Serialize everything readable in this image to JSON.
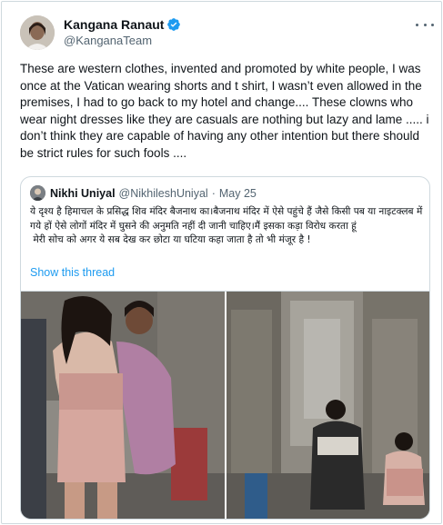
{
  "tweet": {
    "author": {
      "name": "Kangana Ranaut",
      "handle": "@KanganaTeam",
      "verified_color": "#1d9bf0"
    },
    "text": "These are western clothes, invented and promoted by white people, I was once at the Vatican wearing shorts and t shirt, I wasn’t even allowed in the premises, I had to go back to my hotel and change.... These clowns who wear night dresses like they are casuals are nothing but lazy and lame ..... i don’t think they are capable of having any other intention but there should be strict rules for such fools ...."
  },
  "quoted": {
    "author_name": "Nikhi Uniyal",
    "handle": "@NikhileshUniyal",
    "separator": "·",
    "date": "May 25",
    "text": "ये दृश्य है हिमाचल के प्रसिद्ध शिव मंदिर बैजनाथ का।बैजनाथ मंदिर में ऐसे पहुंचे हैं जैसे किसी पब या नाइटक्लब में गये हों ऐसे लोगों मंदिर में घुसने की अनुमति नहीं दी जानी चाहिए।मैं इसका कड़ा विरोध करता हूं\n मेरी सोच को अगर ये सब देख कर छोटा या घटिया कहा जाता है तो भी मंजूर है !",
    "show_thread": "Show this thread"
  },
  "icons": {
    "verified": "verified-badge-icon",
    "more": "more-options-icon"
  },
  "colors": {
    "link": "#1d9bf0",
    "secondary_text": "#536471",
    "border": "#cfd9de"
  }
}
